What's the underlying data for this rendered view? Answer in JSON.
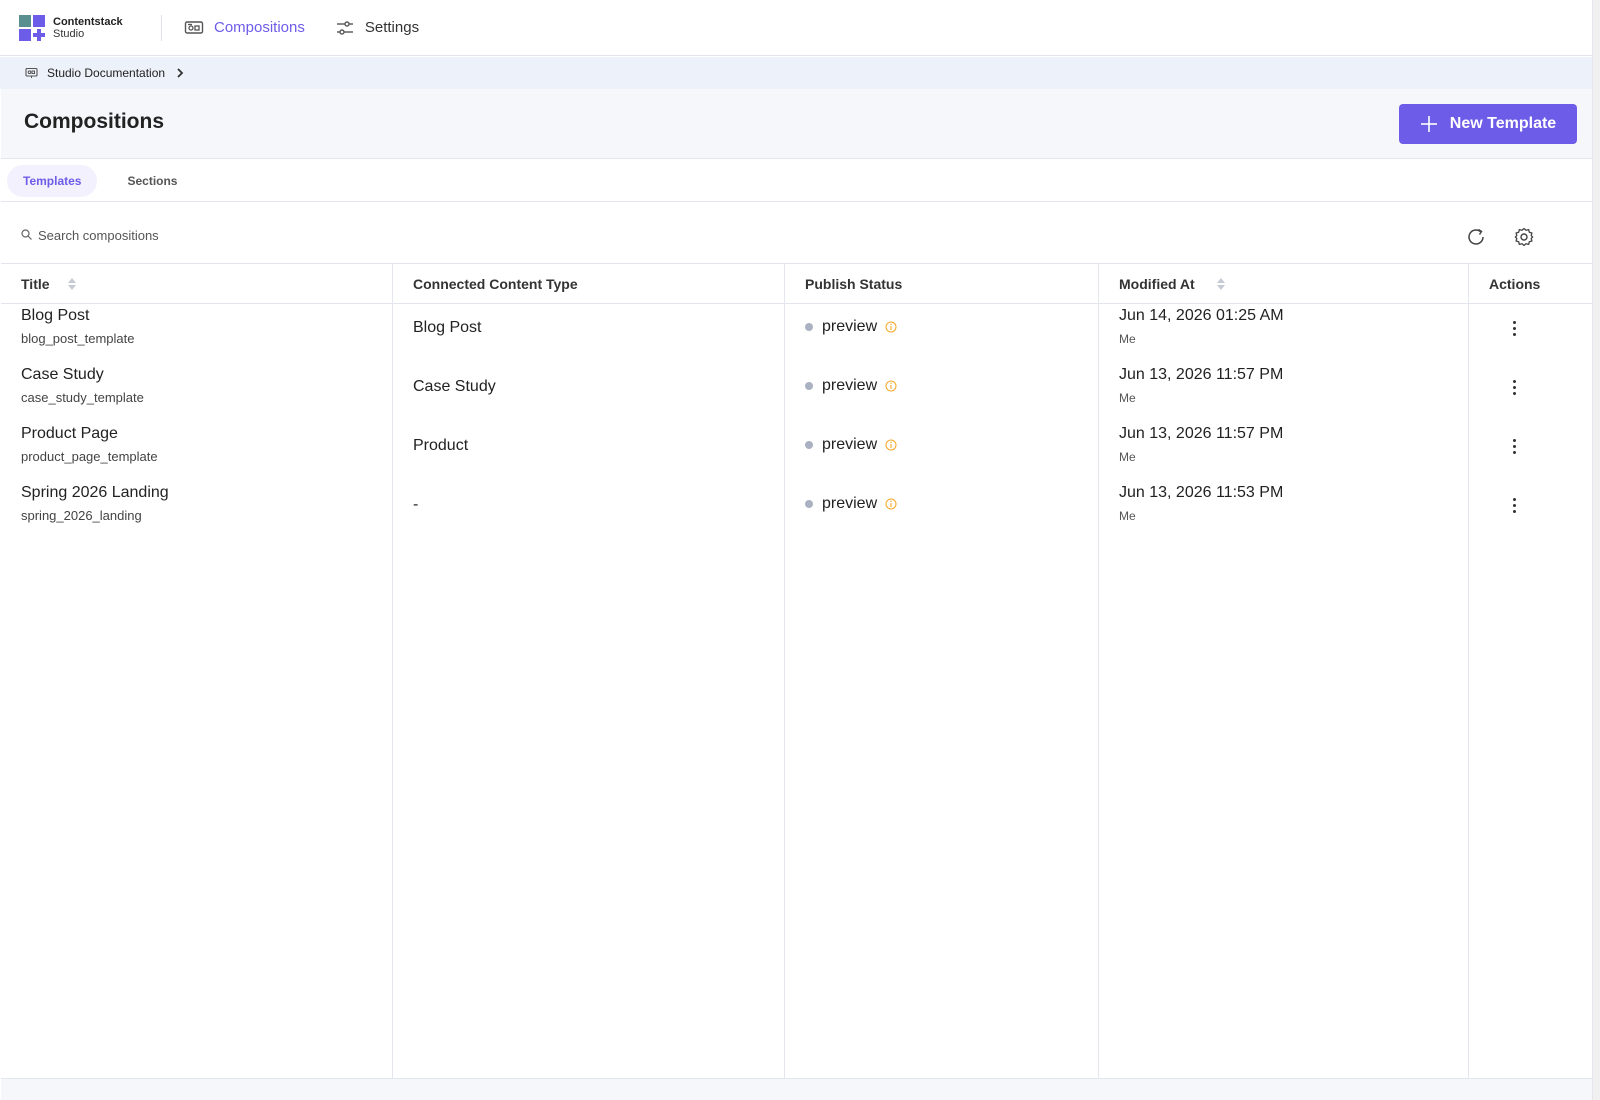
{
  "app": {
    "brand_line1": "Contentstack",
    "brand_line2": "Studio"
  },
  "nav": [
    {
      "label": "Compositions",
      "active": true,
      "icon": "compositions-icon"
    },
    {
      "label": "Settings",
      "active": false,
      "icon": "sliders-icon"
    }
  ],
  "breadcrumb": {
    "label": "Studio Documentation"
  },
  "header": {
    "title": "Compositions",
    "new_button": "New Template"
  },
  "tabs": [
    {
      "label": "Templates",
      "active": true
    },
    {
      "label": "Sections",
      "active": false
    }
  ],
  "search": {
    "placeholder": "Search compositions",
    "value": ""
  },
  "table": {
    "columns": [
      "Title",
      "Connected Content Type",
      "Publish Status",
      "Modified At",
      "Actions"
    ],
    "rows": [
      {
        "title": "Blog Post",
        "uid": "blog_post_template",
        "content_type": "Blog Post",
        "status": "preview",
        "modified": "Jun 14, 2026 01:25 AM",
        "by": "Me"
      },
      {
        "title": "Case Study",
        "uid": "case_study_template",
        "content_type": "Case Study",
        "status": "preview",
        "modified": "Jun 13, 2026 11:57 PM",
        "by": "Me"
      },
      {
        "title": "Product Page",
        "uid": "product_page_template",
        "content_type": "Product",
        "status": "preview",
        "modified": "Jun 13, 2026 11:57 PM",
        "by": "Me"
      },
      {
        "title": "Spring 2026 Landing",
        "uid": "spring_2026_landing",
        "content_type": "-",
        "status": "preview",
        "modified": "Jun 13, 2026 11:53 PM",
        "by": "Me"
      }
    ]
  },
  "colors": {
    "accent": "#6c5ce7",
    "status_dot": "#a9b1c2",
    "info_warn": "#f5a623"
  }
}
